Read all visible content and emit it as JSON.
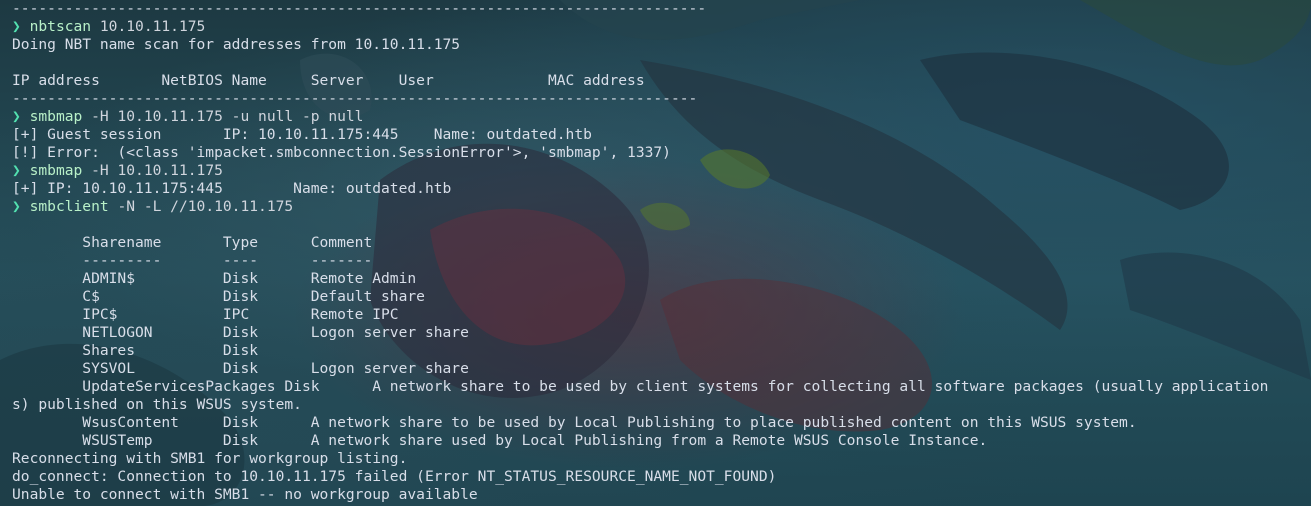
{
  "terminal": {
    "prompt_symbol": "❯",
    "lines": [
      {
        "kind": "output",
        "text": "-------------------------------------------------------------------------------"
      },
      {
        "kind": "command",
        "cmd": "nbtscan",
        "args": " 10.10.11.175"
      },
      {
        "kind": "output",
        "text": "Doing NBT name scan for addresses from 10.10.11.175"
      },
      {
        "kind": "output",
        "text": ""
      },
      {
        "kind": "output",
        "text": "IP address       NetBIOS Name     Server    User             MAC address"
      },
      {
        "kind": "output",
        "text": "------------------------------------------------------------------------------"
      },
      {
        "kind": "command",
        "cmd": "smbmap",
        "args": " -H 10.10.11.175 -u null -p null"
      },
      {
        "kind": "output",
        "text": "[+] Guest session       IP: 10.10.11.175:445    Name: outdated.htb"
      },
      {
        "kind": "output",
        "text": "[!] Error:  (<class 'impacket.smbconnection.SessionError'>, 'smbmap', 1337)"
      },
      {
        "kind": "command",
        "cmd": "smbmap",
        "args": " -H 10.10.11.175"
      },
      {
        "kind": "output",
        "text": "[+] IP: 10.10.11.175:445        Name: outdated.htb"
      },
      {
        "kind": "command",
        "cmd": "smbclient",
        "args": " -N -L //10.10.11.175"
      },
      {
        "kind": "output",
        "text": ""
      },
      {
        "kind": "output",
        "text": "        Sharename       Type      Comment"
      },
      {
        "kind": "output",
        "text": "        ---------       ----      -------"
      },
      {
        "kind": "output",
        "text": "        ADMIN$          Disk      Remote Admin"
      },
      {
        "kind": "output",
        "text": "        C$              Disk      Default share"
      },
      {
        "kind": "output",
        "text": "        IPC$            IPC       Remote IPC"
      },
      {
        "kind": "output",
        "text": "        NETLOGON        Disk      Logon server share"
      },
      {
        "kind": "output",
        "text": "        Shares          Disk"
      },
      {
        "kind": "output",
        "text": "        SYSVOL          Disk      Logon server share"
      },
      {
        "kind": "output",
        "text": "        UpdateServicesPackages Disk      A network share to be used by client systems for collecting all software packages (usually application"
      },
      {
        "kind": "output",
        "text": "s) published on this WSUS system."
      },
      {
        "kind": "output",
        "text": "        WsusContent     Disk      A network share to be used by Local Publishing to place published content on this WSUS system."
      },
      {
        "kind": "output",
        "text": "        WSUSTemp        Disk      A network share used by Local Publishing from a Remote WSUS Console Instance."
      },
      {
        "kind": "output",
        "text": "Reconnecting with SMB1 for workgroup listing."
      },
      {
        "kind": "output",
        "text": "do_connect: Connection to 10.10.11.175 failed (Error NT_STATUS_RESOURCE_NAME_NOT_FOUND)"
      },
      {
        "kind": "output",
        "text": "Unable to connect with SMB1 -- no workgroup available"
      }
    ]
  },
  "colors": {
    "prompt": "#52e0b0",
    "command": "#b8f0c8",
    "output": "#d8dee9",
    "background": "#1b3f4b"
  }
}
